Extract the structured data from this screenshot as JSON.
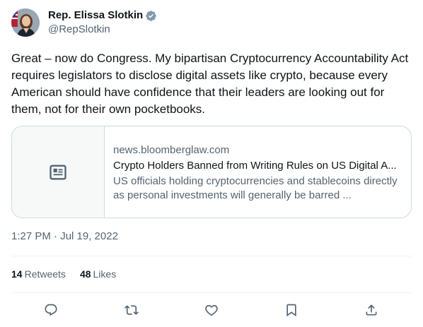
{
  "author": {
    "name": "Rep. Elissa Slotkin",
    "handle": "@RepSlotkin",
    "verified": true
  },
  "tweet": {
    "text": "Great – now do Congress. My bipartisan Cryptocurrency Accountability Act requires legislators to disclose digital assets like crypto, because every American should have confidence that their leaders are looking out for them, not for their own pocketbooks."
  },
  "card": {
    "domain": "news.bloomberglaw.com",
    "title": "Crypto Holders Banned from Writing Rules on US Digital A...",
    "description": "US officials holding cryptocurrencies and stablecoins directly as personal investments will generally be barred ...",
    "thumbnail_icon": "newspaper-icon"
  },
  "meta": {
    "timestamp": "1:27 PM · Jul 19, 2022"
  },
  "stats": {
    "retweets_count": "14",
    "retweets_label": "Retweets",
    "likes_count": "48",
    "likes_label": "Likes"
  },
  "actions": [
    "reply-icon",
    "retweet-icon",
    "like-icon",
    "bookmark-icon",
    "share-icon"
  ],
  "colors": {
    "text_primary": "#0f1419",
    "text_secondary": "#536471",
    "border": "#cfd9de",
    "verified_badge": "#829aab"
  }
}
